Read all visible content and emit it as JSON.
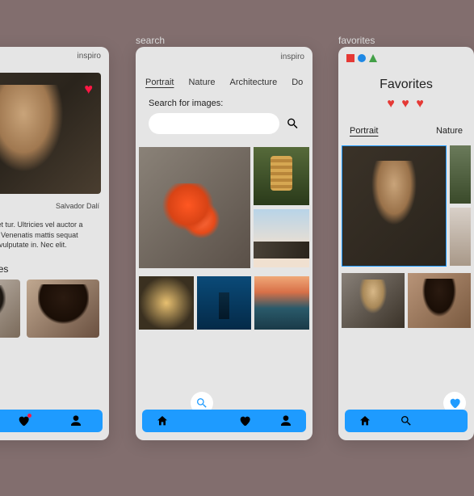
{
  "app_name": "inspiro",
  "screen_labels": {
    "search": "search",
    "favorites": "favorites"
  },
  "detail": {
    "artist": "Salvador Dalí",
    "description": "um dolor sit amet tur. Ultricies vel auctor a pharetra et que. Venenatis mattis sequat faucibus urna n vulputate in. Nec elit.",
    "related_title": "elated Images"
  },
  "search": {
    "tabs": [
      "Portrait",
      "Nature",
      "Architecture",
      "Do"
    ],
    "active_tab": 0,
    "label": "Search for images:",
    "placeholder": ""
  },
  "favorites": {
    "title": "Favorites",
    "tabs": [
      "Portrait",
      "Nature"
    ],
    "active_tab": 0
  },
  "nav": {
    "items": [
      "home",
      "search",
      "favorites",
      "profile"
    ]
  }
}
